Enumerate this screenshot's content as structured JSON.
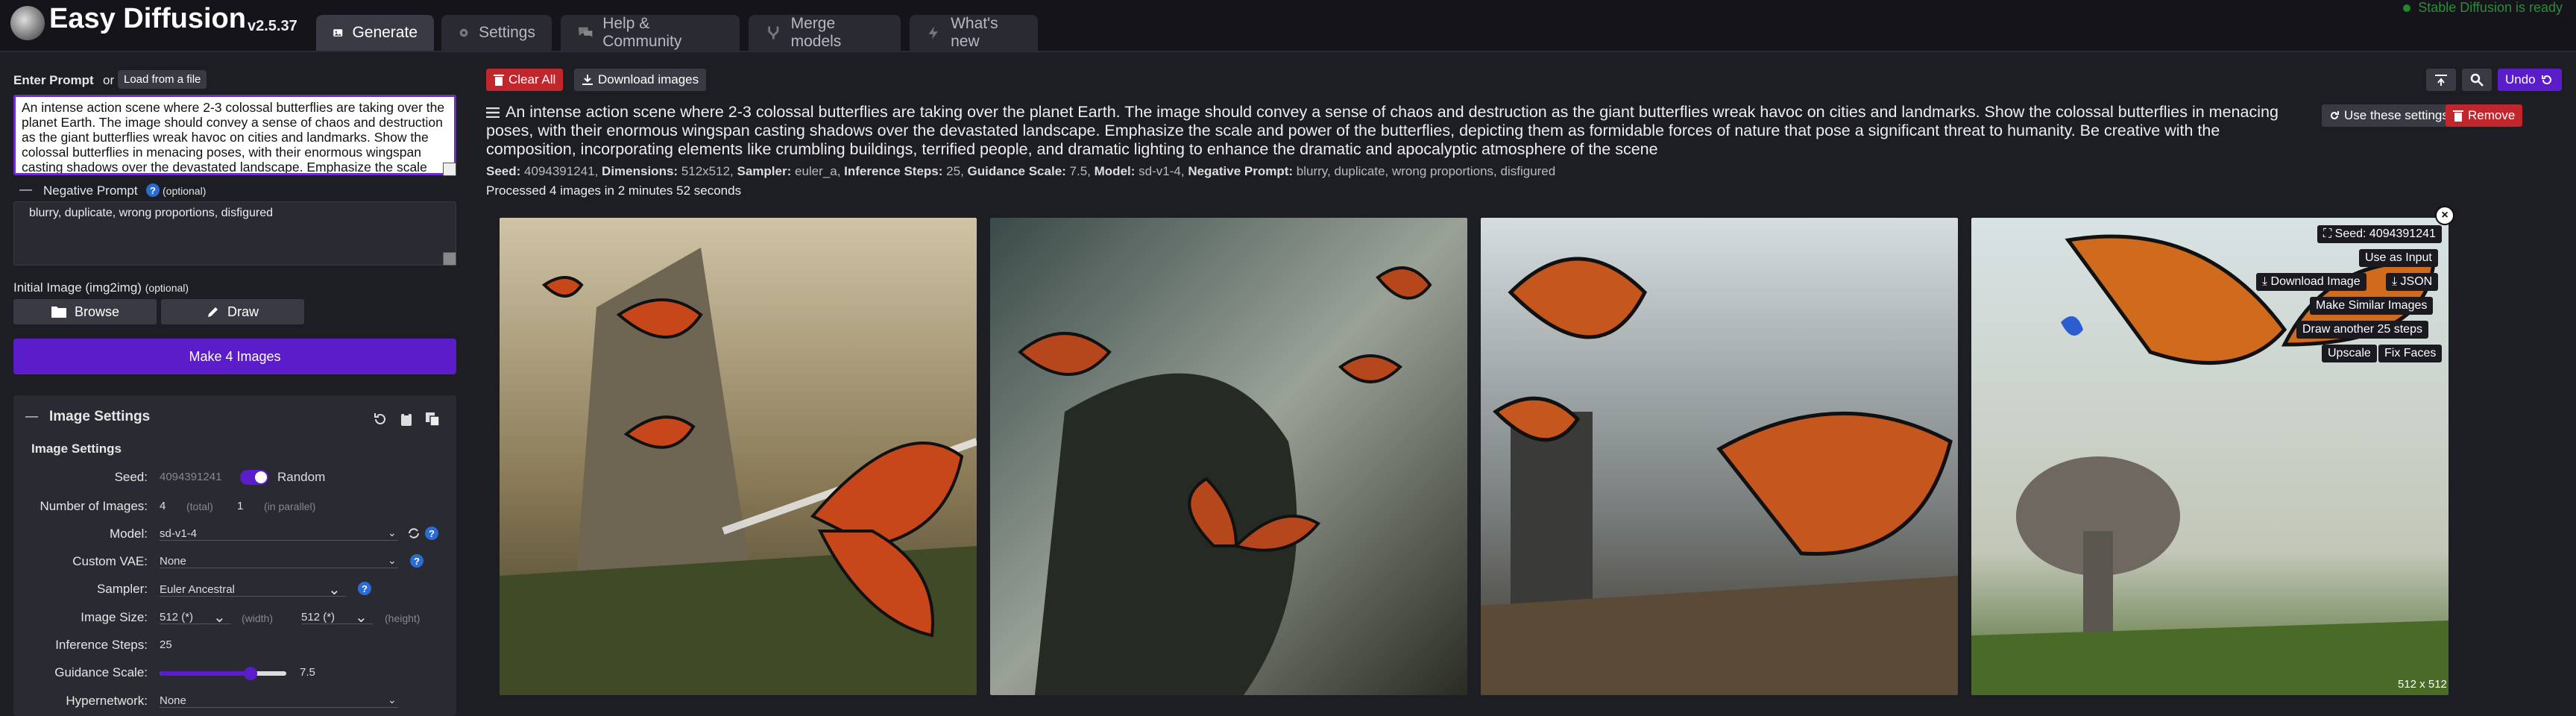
{
  "app": {
    "title": "Easy Diffusion",
    "version": "v2.5.37",
    "status": "Stable Diffusion is ready"
  },
  "tabs": [
    {
      "label": "Generate",
      "icon": "image-icon",
      "active": true
    },
    {
      "label": "Settings",
      "icon": "gear-icon"
    },
    {
      "label": "Help & Community",
      "icon": "chat-icon"
    },
    {
      "label": "Merge models",
      "icon": "merge-icon"
    },
    {
      "label": "What's new",
      "icon": "bolt-icon"
    }
  ],
  "prompt": {
    "label": "Enter Prompt",
    "or": "or",
    "load_button": "Load from a file",
    "value": "An intense action scene where 2-3 colossal butterflies are taking over the planet Earth. The image should convey a sense of chaos and destruction as the giant butterflies wreak havoc on cities and landmarks. Show the colossal butterflies in menacing poses, with their enormous wingspan casting shadows over the devastated landscape. Emphasize the scale and power of the butterflies, depicting them as formidable forces of nature that pose a significant threat to humanity. Be creative with the composition, incorporating elements like crumbling buildings, terrified people, and dramatic lighting to enhance the dramatic and apocalyptic atmosphere of the scene"
  },
  "negative": {
    "toggle": "—",
    "label": "Negative Prompt",
    "optional": "(optional)",
    "value": "blurry, duplicate, wrong proportions, disfigured"
  },
  "init_image": {
    "label": "Initial Image (img2img)",
    "optional": "(optional)",
    "browse": "Browse",
    "draw": "Draw"
  },
  "make_button": "Make 4 Images",
  "image_settings": {
    "toggle": "—",
    "title": "Image Settings",
    "subtitle": "Image Settings",
    "seed_label": "Seed:",
    "seed_value": "4094391241",
    "random_label": "Random",
    "num_images_label": "Number of Images:",
    "num_total": "4",
    "total_text": "(total)",
    "num_parallel": "1",
    "parallel_text": "(in parallel)",
    "model_label": "Model:",
    "model_value": "sd-v1-4",
    "vae_label": "Custom VAE:",
    "vae_value": "None",
    "sampler_label": "Sampler:",
    "sampler_value": "Euler Ancestral",
    "size_label": "Image Size:",
    "width_value": "512 (*)",
    "width_text": "(width)",
    "height_value": "512 (*)",
    "height_text": "(height)",
    "steps_label": "Inference Steps:",
    "steps_value": "25",
    "guidance_label": "Guidance Scale:",
    "guidance_value": "7.5",
    "guidance_fraction": 0.72,
    "hypernetwork_label": "Hypernetwork:",
    "hypernetwork_value": "None"
  },
  "toolbar": {
    "clear_all": "Clear All",
    "download_images": "Download images",
    "undo": "Undo"
  },
  "task": {
    "prompt": "An intense action scene where 2-3 colossal butterflies are taking over the planet Earth. The image should convey a sense of chaos and destruction as the giant butterflies wreak havoc on cities and landmarks. Show the colossal butterflies in menacing poses, with their enormous wingspan casting shadows over the devastated landscape. Emphasize the scale and power of the butterflies, depicting them as formidable forces of nature that pose a significant threat to humanity. Be creative with the composition, incorporating elements like crumbling buildings, terrified people, and dramatic lighting to enhance the dramatic and apocalyptic atmosphere of the scene",
    "use_settings": "Use these settings",
    "remove": "Remove",
    "meta": {
      "seed_key": "Seed:",
      "seed": "4094391241,",
      "dim_key": "Dimensions:",
      "dim": "512x512,",
      "sampler_key": "Sampler:",
      "sampler": "euler_a,",
      "steps_key": "Inference Steps:",
      "steps": "25,",
      "guidance_key": "Guidance Scale:",
      "guidance": "7.5,",
      "model_key": "Model:",
      "model": "sd-v1-4,",
      "neg_key": "Negative Prompt:",
      "neg": "blurry, duplicate, wrong proportions, disfigured"
    },
    "processed": "Processed 4 images in 2 minutes 52 seconds"
  },
  "overlay": {
    "seed": "Seed: 4094391241",
    "use_as_input": "Use as Input",
    "download_image": "Download Image",
    "json": "JSON",
    "make_similar": "Make Similar Images",
    "draw_another": "Draw another 25 steps",
    "upscale": "Upscale",
    "fix_faces": "Fix Faces",
    "size": "512 x 512"
  },
  "colors": {
    "accent": "#5b1cc9",
    "danger": "#c0262c",
    "bg": "#1d1d24",
    "panel": "#2a2a33"
  }
}
